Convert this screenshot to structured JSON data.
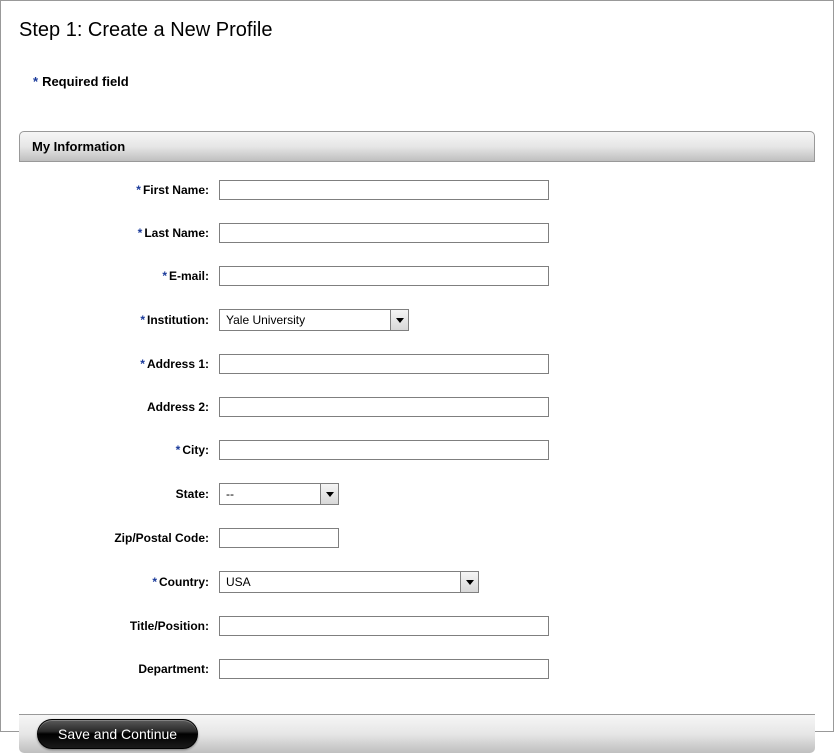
{
  "page": {
    "title": "Step 1: Create a New Profile",
    "required_legend": "Required field"
  },
  "section": {
    "header": "My Information"
  },
  "fields": {
    "first_name": {
      "label": "First Name:",
      "value": ""
    },
    "last_name": {
      "label": "Last Name:",
      "value": ""
    },
    "email": {
      "label": "E-mail:",
      "value": ""
    },
    "institution": {
      "label": "Institution:",
      "value": "Yale University"
    },
    "address1": {
      "label": "Address 1:",
      "value": ""
    },
    "address2": {
      "label": "Address 2:",
      "value": ""
    },
    "city": {
      "label": "City:",
      "value": ""
    },
    "state": {
      "label": "State:",
      "value": "--"
    },
    "zip": {
      "label": "Zip/Postal Code:",
      "value": ""
    },
    "country": {
      "label": "Country:",
      "value": "USA"
    },
    "title_position": {
      "label": "Title/Position:",
      "value": ""
    },
    "department": {
      "label": "Department:",
      "value": ""
    }
  },
  "buttons": {
    "save": "Save and Continue"
  }
}
